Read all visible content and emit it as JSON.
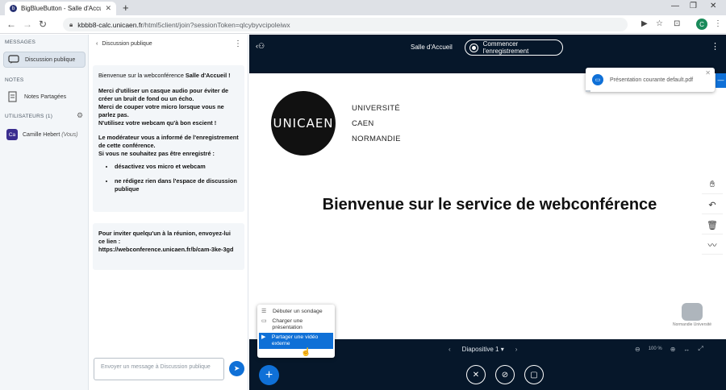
{
  "browser": {
    "tab_title": "BigBlueButton - Salle d'Accueil",
    "url_domain": "kbbb8-calc.unicaen.fr",
    "url_path": "/html5client/join?sessionToken=qlcybyvcipoleiwx",
    "profile_initial": "C"
  },
  "sidebar": {
    "messages_title": "MESSAGES",
    "public_chat_label": "Discussion publique",
    "notes_title": "NOTES",
    "shared_notes_label": "Notes Partagées",
    "users_title": "UTILISATEURS (1)",
    "user_initials": "Ca",
    "user_name": "Camille Hebert",
    "user_you": "(Vous)"
  },
  "chat": {
    "header": "Discussion publique",
    "welcome_prefix": "Bienvenue sur la webconférence ",
    "welcome_room": "Salle d'Accueil",
    "welcome_suffix": " !",
    "line1": "Merci d'utiliser un casque audio pour éviter de créer un bruit de fond ou un écho.",
    "line2": "Merci de couper votre micro lorsque vous ne parlez pas.",
    "line3": "N'utilisez votre webcam qu'à bon escient !",
    "line4": "Le modérateur vous a informé de l'enregistrement de cette conférence.",
    "line5": "Si vous ne souhaitez pas être enregistré :",
    "bullet1": "désactivez vos micro et webcam",
    "bullet2": "ne rédigez rien dans l'espace de discussion publique",
    "invite_text": "Pour inviter quelqu'un à la réunion, envoyez-lui ce lien :",
    "invite_link": "https://webconference.unicaen.fr/b/cam-3ke-3gd",
    "input_placeholder": "Envoyer un message à Discussion publique"
  },
  "main": {
    "room_title": "Salle d'Accueil",
    "record_label": "Commencer l'enregistrement",
    "slide": {
      "logo_text": "UNICAEN",
      "logo_line1": "UNIVERSITÉ",
      "logo_line2": "CAEN",
      "logo_line3": "NORMANDIE",
      "title": "Bienvenue sur le service de webconférence",
      "footer_logo_label": "Normandie Université"
    },
    "slide_selector": "Diapositive 1",
    "zoom_value": "100 %"
  },
  "toast": {
    "text": "Présentation courante default.pdf"
  },
  "action_menu": {
    "items": [
      {
        "label": "Débuter un sondage",
        "icon": "poll-icon"
      },
      {
        "label": "Charger une présentation",
        "icon": "presentation-icon"
      },
      {
        "label": "Partager une vidéo externe",
        "icon": "video-icon"
      }
    ]
  },
  "colors": {
    "accent": "#0f70d7",
    "dark_bg": "#06172a"
  }
}
